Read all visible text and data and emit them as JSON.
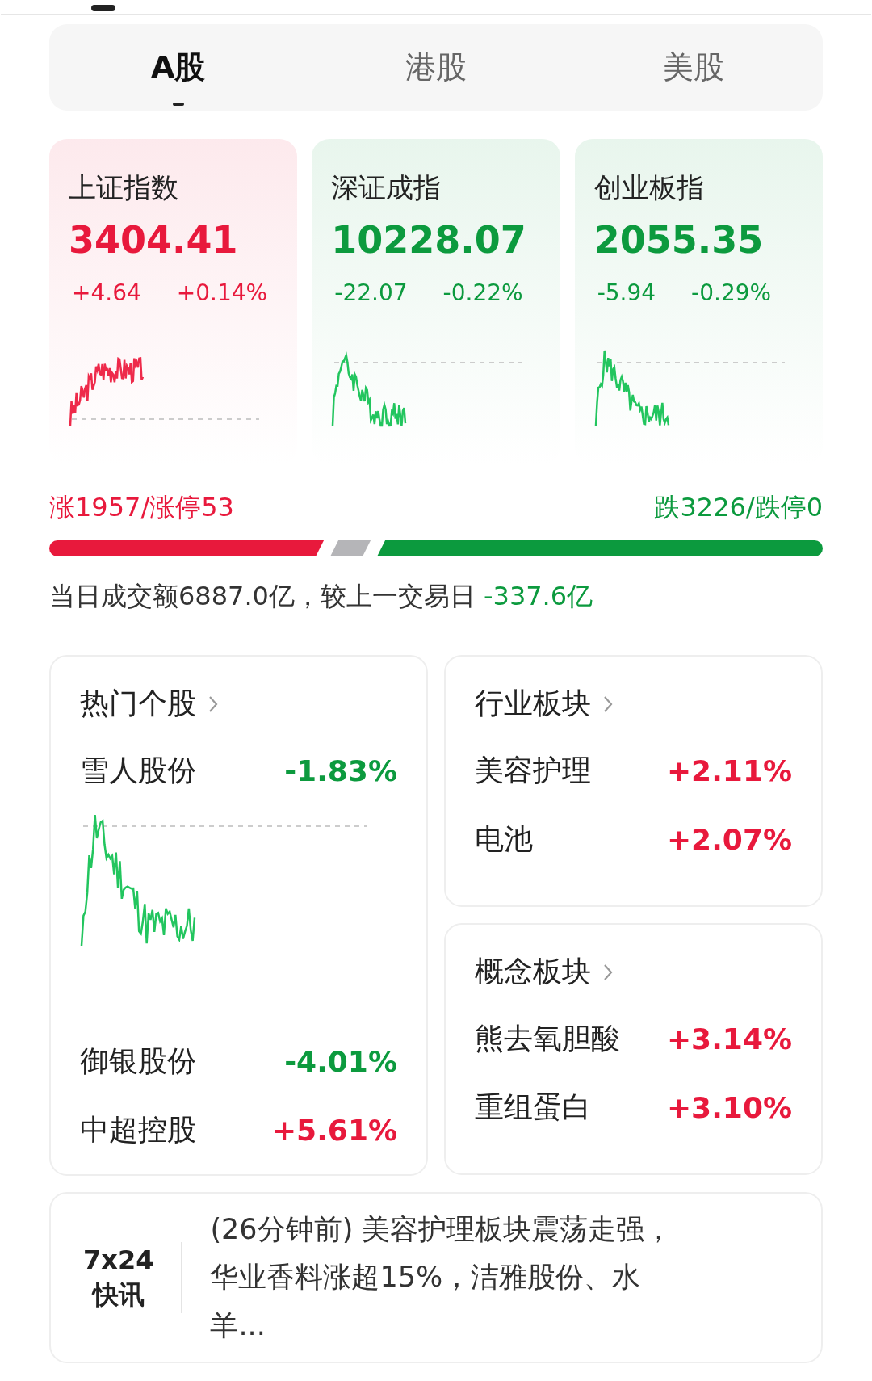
{
  "tabs": [
    {
      "label": "A股",
      "selected": true
    },
    {
      "label": "港股",
      "selected": false
    },
    {
      "label": "美股",
      "selected": false
    }
  ],
  "indices": [
    {
      "name": "上证指数",
      "value": "3404.41",
      "change": "+4.64",
      "percent": "+0.14%",
      "color": "#e8193c"
    },
    {
      "name": "深证成指",
      "value": "10228.07",
      "change": "-22.07",
      "percent": "-0.22%",
      "color": "#0c9a3e"
    },
    {
      "name": "创业板指",
      "value": "2055.35",
      "change": "-5.94",
      "percent": "-0.29%",
      "color": "#0c9a3e"
    }
  ],
  "breadth": {
    "up_text": "涨1957/涨停53",
    "down_text": "跌3226/跌停0"
  },
  "turnover": {
    "text": "当日成交额6887.0亿，较上一交易日",
    "delta": "-337.6亿"
  },
  "hot_stocks": {
    "title": "热门个股",
    "featured": {
      "name": "雪人股份",
      "change": "-1.83%",
      "color": "#0c9a3e"
    },
    "items": [
      {
        "name": "御银股份",
        "change": "-4.01%",
        "color": "#0c9a3e"
      },
      {
        "name": "中超控股",
        "change": "+5.61%",
        "color": "#e8193c"
      }
    ]
  },
  "sectors": [
    {
      "title": "行业板块",
      "items": [
        {
          "name": "美容护理",
          "change": "+2.11%",
          "color": "#e8193c"
        },
        {
          "name": "电池",
          "change": "+2.07%",
          "color": "#e8193c"
        }
      ]
    },
    {
      "title": "概念板块",
      "items": [
        {
          "name": "熊去氧胆酸",
          "change": "+3.14%",
          "color": "#e8193c"
        },
        {
          "name": "重组蛋白",
          "change": "+3.10%",
          "color": "#e8193c"
        }
      ]
    }
  ],
  "news": {
    "badge_top": "7x24",
    "badge_bottom": "快讯",
    "text": "(26分钟前) 美容护理板块震荡走强，华业香料涨超15%，洁雅股份、水羊..."
  }
}
